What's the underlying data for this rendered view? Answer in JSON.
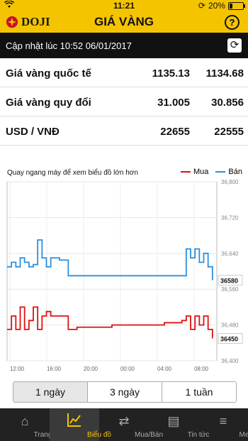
{
  "status": {
    "time": "11:21",
    "battery": "20%",
    "battery_level": 0.2
  },
  "header": {
    "brand": "DOJI",
    "title": "GIÁ VÀNG",
    "help_label": "?"
  },
  "update": {
    "text": "Cập nhật lúc 10:52 06/01/2017"
  },
  "rates": [
    {
      "name": "Giá vàng quốc tế",
      "v1": "1135.13",
      "v2": "1134.68"
    },
    {
      "name": "Giá vàng quy đổi",
      "v1": "31.005",
      "v2": "30.856"
    },
    {
      "name": "USD / VNĐ",
      "v1": "22655",
      "v2": "22555"
    }
  ],
  "chart": {
    "hint": "Quay ngang máy để xem biểu đồ lớn hơn",
    "legend": {
      "mua": "Mua",
      "ban": "Bán"
    },
    "colors": {
      "mua": "#e01010",
      "ban": "#2a8fe0"
    }
  },
  "chart_data": {
    "type": "line",
    "x_ticks": [
      "12:00",
      "16:00",
      "20:00",
      "00:00",
      "04:00",
      "08:00"
    ],
    "ylim": [
      36400,
      36800
    ],
    "y_ticks": [
      36400,
      36480,
      36560,
      36640,
      36720,
      36800
    ],
    "y_tick_labels": [
      "36,400",
      "36,480",
      "36,560",
      "36,640",
      "36,720",
      "36,800"
    ],
    "last_labels": {
      "ban": "36580",
      "mua": "36450"
    },
    "x_range": [
      0,
      24
    ],
    "series": [
      {
        "name": "Bán",
        "color": "#2a8fe0",
        "x": [
          0,
          0.5,
          1,
          1.5,
          2,
          2.5,
          3,
          3.5,
          4,
          4.5,
          5,
          6,
          7,
          8,
          10,
          14,
          18,
          20,
          20.5,
          21,
          21.5,
          22,
          22.5,
          23,
          23.5
        ],
        "y": [
          36610,
          36620,
          36610,
          36630,
          36620,
          36610,
          36615,
          36670,
          36630,
          36610,
          36630,
          36625,
          36590,
          36590,
          36590,
          36590,
          36590,
          36590,
          36650,
          36630,
          36650,
          36620,
          36640,
          36610,
          36580
        ]
      },
      {
        "name": "Mua",
        "color": "#e01010",
        "x": [
          0,
          0.5,
          1,
          1.5,
          2,
          2.5,
          3,
          3.5,
          4,
          4.5,
          5,
          6,
          7,
          7.5,
          8,
          12,
          18,
          20,
          20.5,
          21,
          21.5,
          22,
          22.5,
          23,
          23.5
        ],
        "y": [
          36470,
          36500,
          36470,
          36520,
          36470,
          36490,
          36520,
          36470,
          36500,
          36510,
          36500,
          36500,
          36470,
          36470,
          36475,
          36480,
          36485,
          36490,
          36500,
          36470,
          36500,
          36480,
          36500,
          36470,
          36450
        ]
      }
    ]
  },
  "tabs": [
    {
      "label": "1 ngày",
      "active": true
    },
    {
      "label": "3 ngày",
      "active": false
    },
    {
      "label": "1 tuần",
      "active": false
    }
  ],
  "nav": [
    {
      "label": "Trang chủ",
      "icon": "home-icon",
      "active": false
    },
    {
      "label": "Biểu đồ",
      "icon": "chart-icon",
      "active": true
    },
    {
      "label": "Mua/Bán",
      "icon": "exchange-icon",
      "active": false
    },
    {
      "label": "Tin tức",
      "icon": "news-icon",
      "active": false
    },
    {
      "label": "Menu",
      "icon": "menu-icon",
      "active": false
    }
  ]
}
